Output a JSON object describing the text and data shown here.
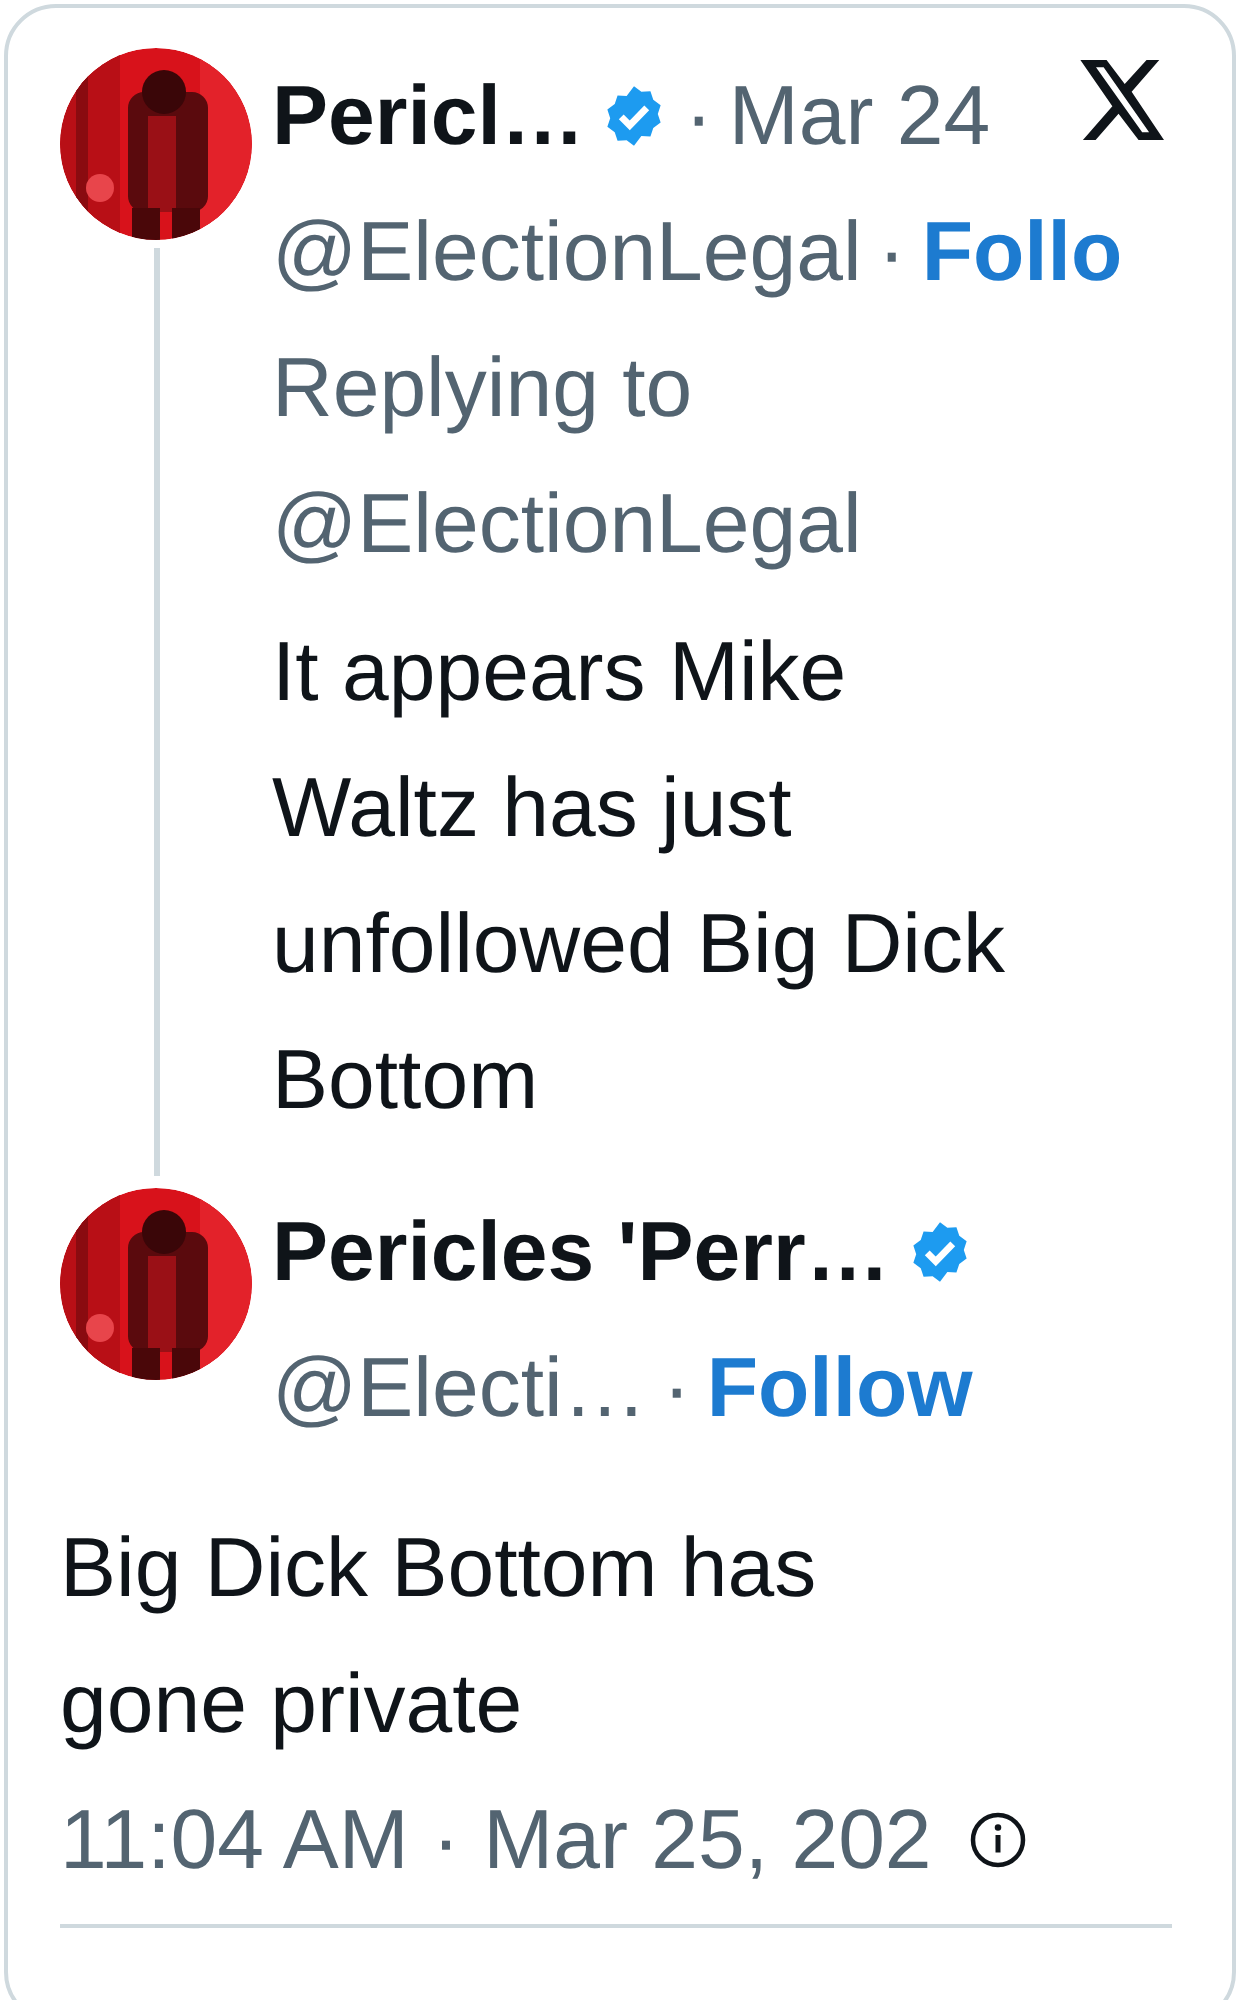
{
  "posts": [
    {
      "kind": "parent",
      "author": "Pericl…",
      "verified": true,
      "separator": "·",
      "date": "Mar 24",
      "handle": "@ElectionLegal",
      "follow_separator": "·",
      "follow": "Follo",
      "reply_label": "Replying to",
      "reply_to": "@ElectionLegal",
      "text": "It appears Mike Waltz has just unfollowed Big Dick Bottom"
    },
    {
      "kind": "focus",
      "author": "Pericles 'Perr…",
      "verified": true,
      "handle": "@Electi…",
      "follow_separator": "·",
      "follow": "Follow",
      "text": "Big Dick Bottom has gone private",
      "timestamp": "11:04 AM · Mar 25, 202"
    }
  ]
}
